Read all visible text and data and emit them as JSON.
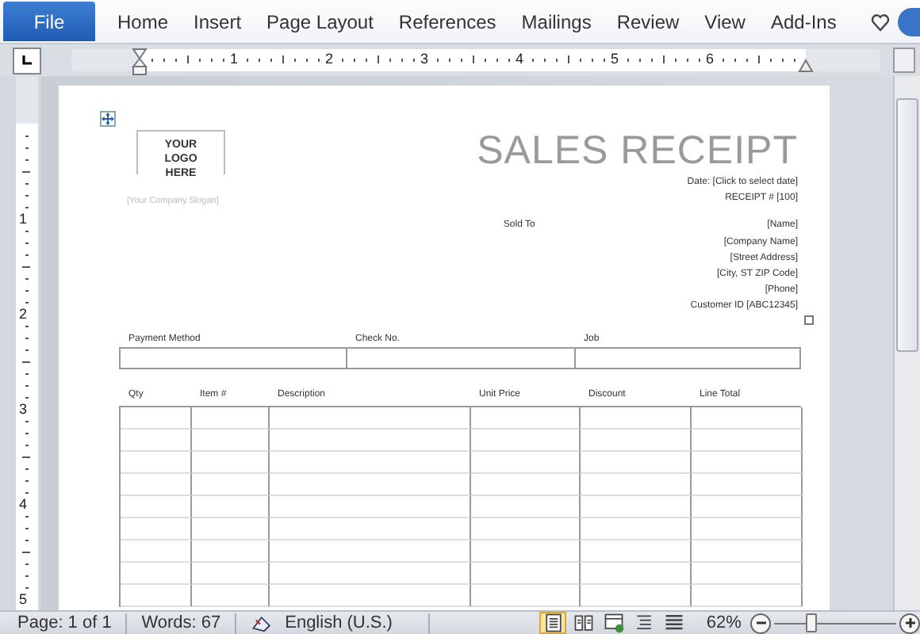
{
  "ribbon": {
    "tabs": [
      {
        "label": "File",
        "kind": "file"
      },
      {
        "label": "Home",
        "kind": "tab"
      },
      {
        "label": "Insert",
        "kind": "tab"
      },
      {
        "label": "Page Layout",
        "kind": "tab"
      },
      {
        "label": "References",
        "kind": "tab"
      },
      {
        "label": "Mailings",
        "kind": "tab"
      },
      {
        "label": "Review",
        "kind": "tab"
      },
      {
        "label": "View",
        "kind": "tab"
      },
      {
        "label": "Add-Ins",
        "kind": "tab"
      }
    ]
  },
  "ruler": {
    "horizontal_marks": [
      "1",
      "2",
      "3",
      "4",
      "5",
      "6"
    ],
    "vertical_marks": [
      "1",
      "2",
      "3",
      "4",
      "5"
    ]
  },
  "document": {
    "logo": "YOUR LOGO HERE",
    "title": "SALES RECEIPT",
    "tagline": "[Your Company Slogan]",
    "date_line": "Date: [Click to select date]",
    "receipt_line": "RECEIPT # [100]",
    "sold_to_label": "Sold To",
    "sold_to_lines": [
      "[Name]",
      "[Company Name]",
      "[Street Address]",
      "[City, ST  ZIP Code]",
      "[Phone]",
      "Customer ID [ABC12345]"
    ],
    "payment_headers": [
      "Payment Method",
      "Check No.",
      "Job"
    ],
    "item_headers": [
      "Qty",
      "Item #",
      "Description",
      "Unit Price",
      "Discount",
      "Line Total"
    ]
  },
  "status_bar": {
    "page": "Page: 1 of 1",
    "words": "Words: 67",
    "language": "English (U.S.)",
    "views": [
      {
        "kind": "print",
        "selected": true
      },
      {
        "kind": "reading",
        "selected": false
      },
      {
        "kind": "web",
        "selected": false
      },
      {
        "kind": "outline",
        "selected": false
      },
      {
        "kind": "draft",
        "selected": false
      }
    ],
    "zoom": {
      "reading": "62%",
      "level": 0.3
    }
  }
}
